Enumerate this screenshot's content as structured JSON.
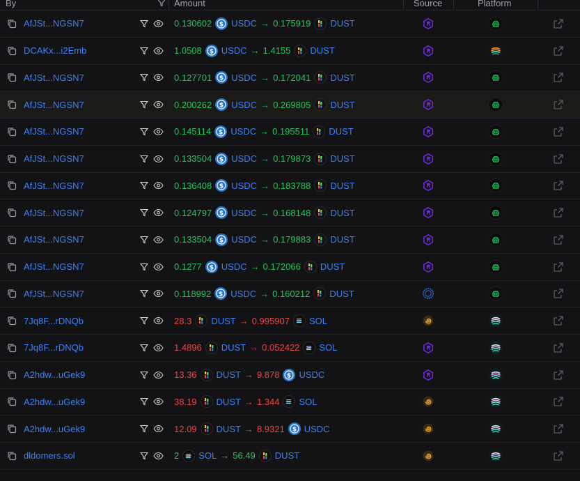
{
  "header": {
    "by": "By",
    "amount": "Amount",
    "source": "Source",
    "platform": "Platform"
  },
  "colors": {
    "link": "#3b82f6",
    "positive": "#22c55e",
    "negative": "#ef4444",
    "usdc": "#2775ca"
  },
  "rows": [
    {
      "addr": "AfJSt...NGSN7",
      "in_amt": "0.130602",
      "in_tok": "USDC",
      "out_amt": "0.175919",
      "out_tok": "DUST",
      "dir": "pos",
      "source": "raydium",
      "platform": "green",
      "hl": false
    },
    {
      "addr": "DCAKx...i2Emb",
      "in_amt": "1.0508",
      "in_tok": "USDC",
      "out_amt": "1.4155",
      "out_tok": "DUST",
      "dir": "pos",
      "source": "raydium",
      "platform": "orange-stripes",
      "hl": false
    },
    {
      "addr": "AfJSt...NGSN7",
      "in_amt": "0.127701",
      "in_tok": "USDC",
      "out_amt": "0.172041",
      "out_tok": "DUST",
      "dir": "pos",
      "source": "raydium",
      "platform": "green",
      "hl": false
    },
    {
      "addr": "AfJSt...NGSN7",
      "in_amt": "0.200262",
      "in_tok": "USDC",
      "out_amt": "0.269805",
      "out_tok": "DUST",
      "dir": "pos",
      "source": "raydium",
      "platform": "green",
      "hl": true
    },
    {
      "addr": "AfJSt...NGSN7",
      "in_amt": "0.145114",
      "in_tok": "USDC",
      "out_amt": "0.195511",
      "out_tok": "DUST",
      "dir": "pos",
      "source": "raydium",
      "platform": "green",
      "hl": false
    },
    {
      "addr": "AfJSt...NGSN7",
      "in_amt": "0.133504",
      "in_tok": "USDC",
      "out_amt": "0.179873",
      "out_tok": "DUST",
      "dir": "pos",
      "source": "raydium",
      "platform": "green",
      "hl": false
    },
    {
      "addr": "AfJSt...NGSN7",
      "in_amt": "0.136408",
      "in_tok": "USDC",
      "out_amt": "0.183788",
      "out_tok": "DUST",
      "dir": "pos",
      "source": "raydium",
      "platform": "green",
      "hl": false
    },
    {
      "addr": "AfJSt...NGSN7",
      "in_amt": "0.124797",
      "in_tok": "USDC",
      "out_amt": "0.168148",
      "out_tok": "DUST",
      "dir": "pos",
      "source": "raydium",
      "platform": "green",
      "hl": false
    },
    {
      "addr": "AfJSt...NGSN7",
      "in_amt": "0.133504",
      "in_tok": "USDC",
      "out_amt": "0.179883",
      "out_tok": "DUST",
      "dir": "pos",
      "source": "raydium",
      "platform": "green",
      "hl": false
    },
    {
      "addr": "AfJSt...NGSN7",
      "in_amt": "0.1277",
      "in_tok": "USDC",
      "out_amt": "0.172066",
      "out_tok": "DUST",
      "dir": "pos",
      "source": "raydium",
      "platform": "green",
      "hl": false
    },
    {
      "addr": "AfJSt...NGSN7",
      "in_amt": "0.118992",
      "in_tok": "USDC",
      "out_amt": "0.160212",
      "out_tok": "DUST",
      "dir": "pos",
      "source": "orca",
      "platform": "green",
      "hl": false
    },
    {
      "addr": "7Jq8F...rDNQb",
      "in_amt": "28.3",
      "in_tok": "DUST",
      "out_amt": "0.995907",
      "out_tok": "SOL",
      "dir": "neg",
      "source": "spiral",
      "platform": "stripes",
      "hl": false
    },
    {
      "addr": "7Jq8F...rDNQb",
      "in_amt": "1.4896",
      "in_tok": "DUST",
      "out_amt": "0.052422",
      "out_tok": "SOL",
      "dir": "neg",
      "source": "raydium",
      "platform": "stripes",
      "hl": false
    },
    {
      "addr": "A2hdw...uGek9",
      "in_amt": "13.36",
      "in_tok": "DUST",
      "out_amt": "9.878",
      "out_tok": "USDC",
      "dir": "neg",
      "source": "raydium",
      "platform": "stripes",
      "hl": false
    },
    {
      "addr": "A2hdw...uGek9",
      "in_amt": "38.19",
      "in_tok": "DUST",
      "out_amt": "1.344",
      "out_tok": "SOL",
      "dir": "neg",
      "source": "spiral",
      "platform": "stripes",
      "hl": false
    },
    {
      "addr": "A2hdw...uGek9",
      "in_amt": "12.09",
      "in_tok": "DUST",
      "out_amt": "8.9321",
      "out_tok": "USDC",
      "dir": "neg",
      "source": "spiral",
      "platform": "stripes",
      "hl": false
    },
    {
      "addr": "dldomers.sol",
      "in_amt": "2",
      "in_tok": "SOL",
      "out_amt": "56.49",
      "out_tok": "DUST",
      "dir": "pos",
      "source": "spiral",
      "platform": "stripes",
      "hl": false
    }
  ]
}
